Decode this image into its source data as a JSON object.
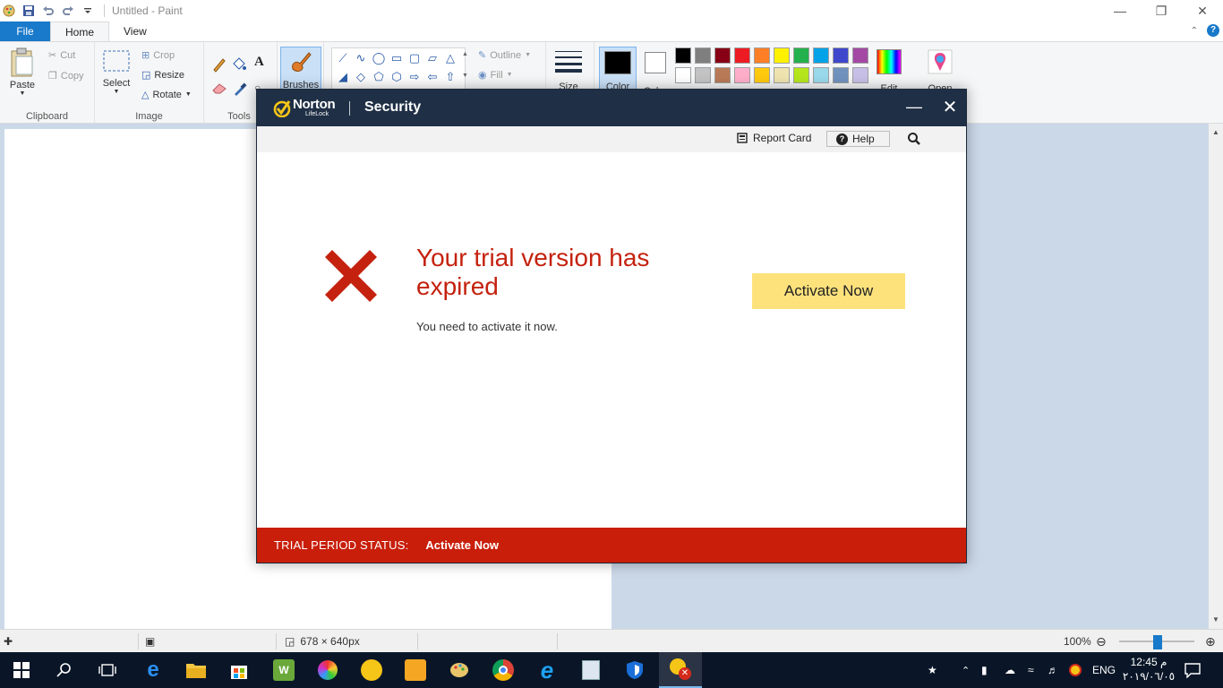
{
  "paint": {
    "window_title": "Untitled - Paint",
    "tabs": [
      "File",
      "Home",
      "View"
    ],
    "clipboard": {
      "paste": "Paste",
      "cut": "Cut",
      "copy": "Copy",
      "label": "Clipboard"
    },
    "image": {
      "select": "Select",
      "crop": "Crop",
      "resize": "Resize",
      "rotate": "Rotate",
      "label": "Image"
    },
    "tools": {
      "label": "Tools"
    },
    "brushes": "Brushes",
    "shapes": {
      "outline": "Outline",
      "fill": "Fill"
    },
    "size": "Size",
    "color1": "Color",
    "color2": "Color",
    "edit_colors": "Edit",
    "open_paint3d": "Open",
    "palette": {
      "row1": [
        "#000000",
        "#7f7f7f",
        "#880015",
        "#ed1c24",
        "#ff7f27",
        "#fff200",
        "#22b14c",
        "#00a2e8",
        "#3f48cc",
        "#a349a4"
      ],
      "row2": [
        "#ffffff",
        "#c3c3c3",
        "#b97a57",
        "#ffaec9",
        "#ffc90e",
        "#efe4b0",
        "#b5e61d",
        "#99d9ea",
        "#7092be",
        "#c8bfe7"
      ]
    },
    "status": {
      "dimensions": "678 × 640px",
      "zoom": "100%"
    }
  },
  "norton": {
    "brand": "Norton",
    "brand_sub": "LifeLock",
    "title": "Security",
    "toolbar": {
      "report_card": "Report Card",
      "help": "Help"
    },
    "error": {
      "heading": "Your trial version has expired",
      "message": "You need to activate it now."
    },
    "activate_button": "Activate Now",
    "footer": {
      "label": "TRIAL PERIOD STATUS:",
      "action": "Activate Now"
    }
  },
  "taskbar": {
    "language": "ENG",
    "time": "12:45 م",
    "date": "٢٠١٩/٠٦/٠٥"
  },
  "colors": {
    "norton_header": "#1f2f45",
    "error_red": "#c4220e",
    "footer_red": "#c81e0a",
    "activate_yellow": "#fde27c",
    "paint_accent": "#1979ca"
  }
}
